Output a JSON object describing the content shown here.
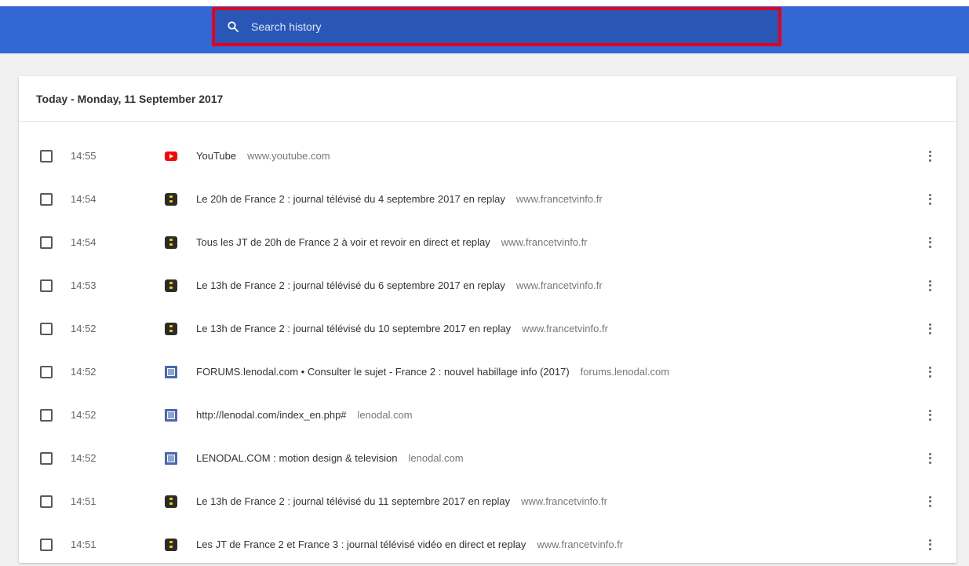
{
  "search": {
    "placeholder": "Search history",
    "value": ""
  },
  "history": {
    "date_header": "Today - Monday, 11 September 2017",
    "items": [
      {
        "time": "14:55",
        "icon": "youtube-icon",
        "title": "YouTube",
        "domain": "www.youtube.com"
      },
      {
        "time": "14:54",
        "icon": "france-tv-icon",
        "title": "Le 20h de France 2 : journal télévisé du 4 septembre 2017 en replay",
        "domain": "www.francetvinfo.fr"
      },
      {
        "time": "14:54",
        "icon": "france-tv-icon",
        "title": "Tous les JT de 20h de France 2 à voir et revoir en direct et replay",
        "domain": "www.francetvinfo.fr"
      },
      {
        "time": "14:53",
        "icon": "france-tv-icon",
        "title": "Le 13h de France 2 : journal télévisé du 6 septembre 2017 en replay",
        "domain": "www.francetvinfo.fr"
      },
      {
        "time": "14:52",
        "icon": "france-tv-icon",
        "title": "Le 13h de France 2 : journal télévisé du 10 septembre 2017 en replay",
        "domain": "www.francetvinfo.fr"
      },
      {
        "time": "14:52",
        "icon": "lenodal-icon",
        "title": "FORUMS.lenodal.com • Consulter le sujet - France 2 : nouvel habillage info (2017)",
        "domain": "forums.lenodal.com"
      },
      {
        "time": "14:52",
        "icon": "lenodal-icon",
        "title": "http://lenodal.com/index_en.php#",
        "domain": "lenodal.com"
      },
      {
        "time": "14:52",
        "icon": "lenodal-icon",
        "title": "LENODAL.COM : motion design & television",
        "domain": "lenodal.com"
      },
      {
        "time": "14:51",
        "icon": "france-tv-icon",
        "title": "Le 13h de France 2 : journal télévisé du 11 septembre 2017 en replay",
        "domain": "www.francetvinfo.fr"
      },
      {
        "time": "14:51",
        "icon": "france-tv-icon",
        "title": "Les JT de France 2 et France 3 : journal télévisé vidéo en direct et replay",
        "domain": "www.francetvinfo.fr"
      }
    ]
  }
}
